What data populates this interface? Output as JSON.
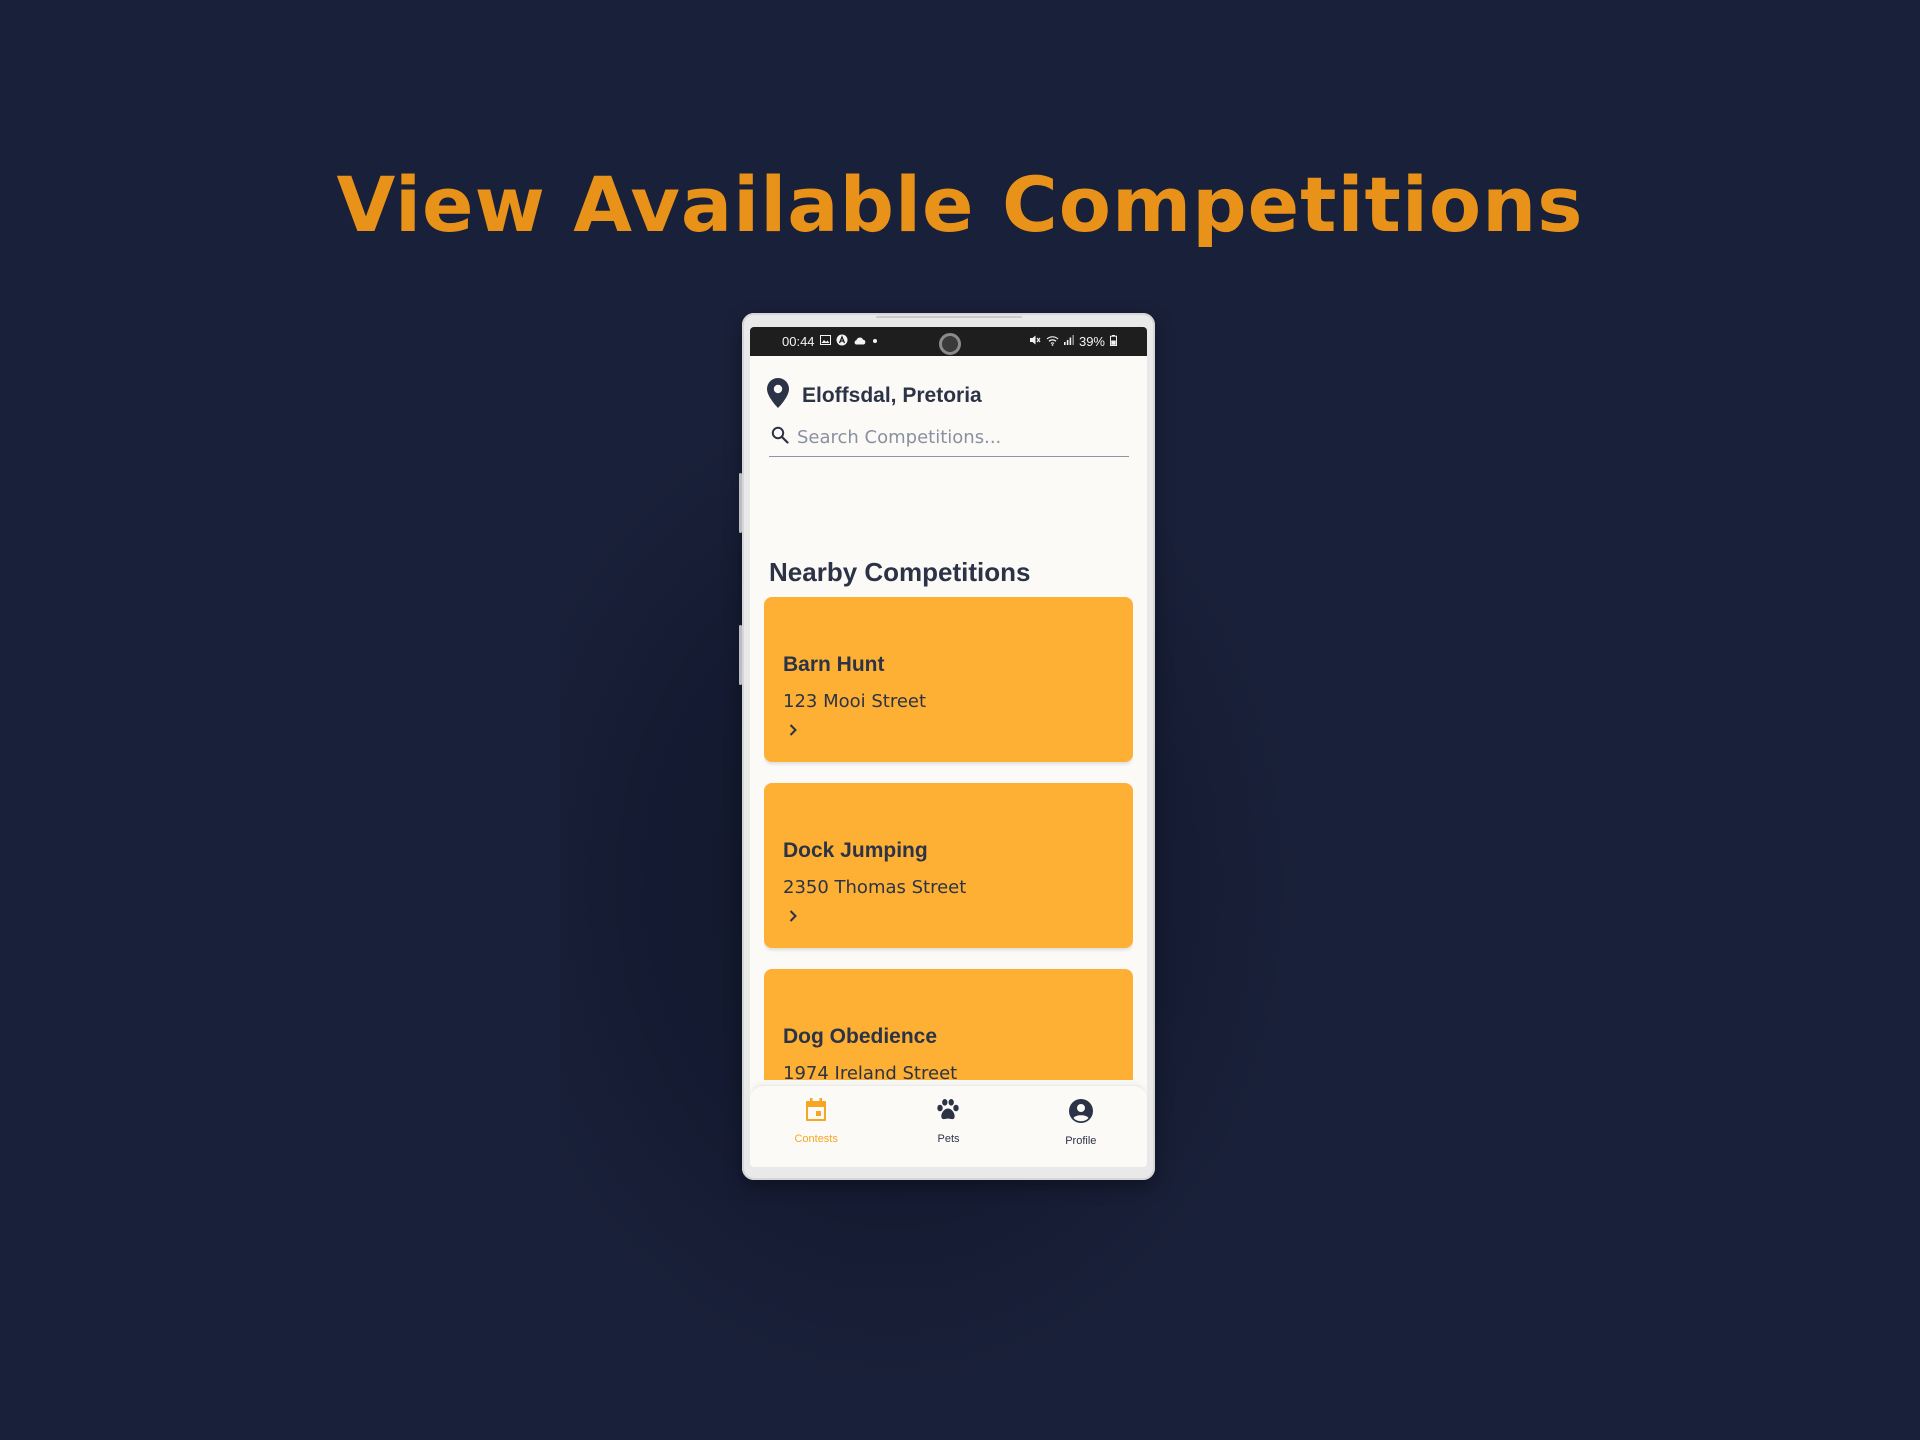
{
  "headline": "View Available Competitions",
  "status_bar": {
    "time": "00:44",
    "battery": "39%",
    "icons": [
      "image-icon",
      "a-badge-icon",
      "cloud-icon",
      "dot-icon",
      "mute-icon",
      "wifi-icon",
      "signal-icon",
      "battery-icon"
    ]
  },
  "location": {
    "icon": "location-pin-icon",
    "text": "Eloffsdal, Pretoria"
  },
  "search": {
    "icon": "search-icon",
    "placeholder": "Search Competitions...",
    "value": ""
  },
  "section_title": "Nearby Competitions",
  "competitions": [
    {
      "name": "Barn Hunt",
      "address": "123 Mooi Street"
    },
    {
      "name": "Dock Jumping",
      "address": "2350 Thomas Street"
    },
    {
      "name": "Dog Obedience",
      "address": "1974 Ireland Street"
    }
  ],
  "nav": {
    "items": [
      {
        "label": "Contests",
        "icon": "calendar-icon",
        "active": true
      },
      {
        "label": "Pets",
        "icon": "paw-icon",
        "active": false
      },
      {
        "label": "Profile",
        "icon": "account-circle-icon",
        "active": false
      }
    ]
  },
  "colors": {
    "background": "#192039",
    "headline": "#e8921a",
    "card": "#fdb033",
    "text_dark": "#2c3346",
    "nav_active": "#f5a623"
  }
}
